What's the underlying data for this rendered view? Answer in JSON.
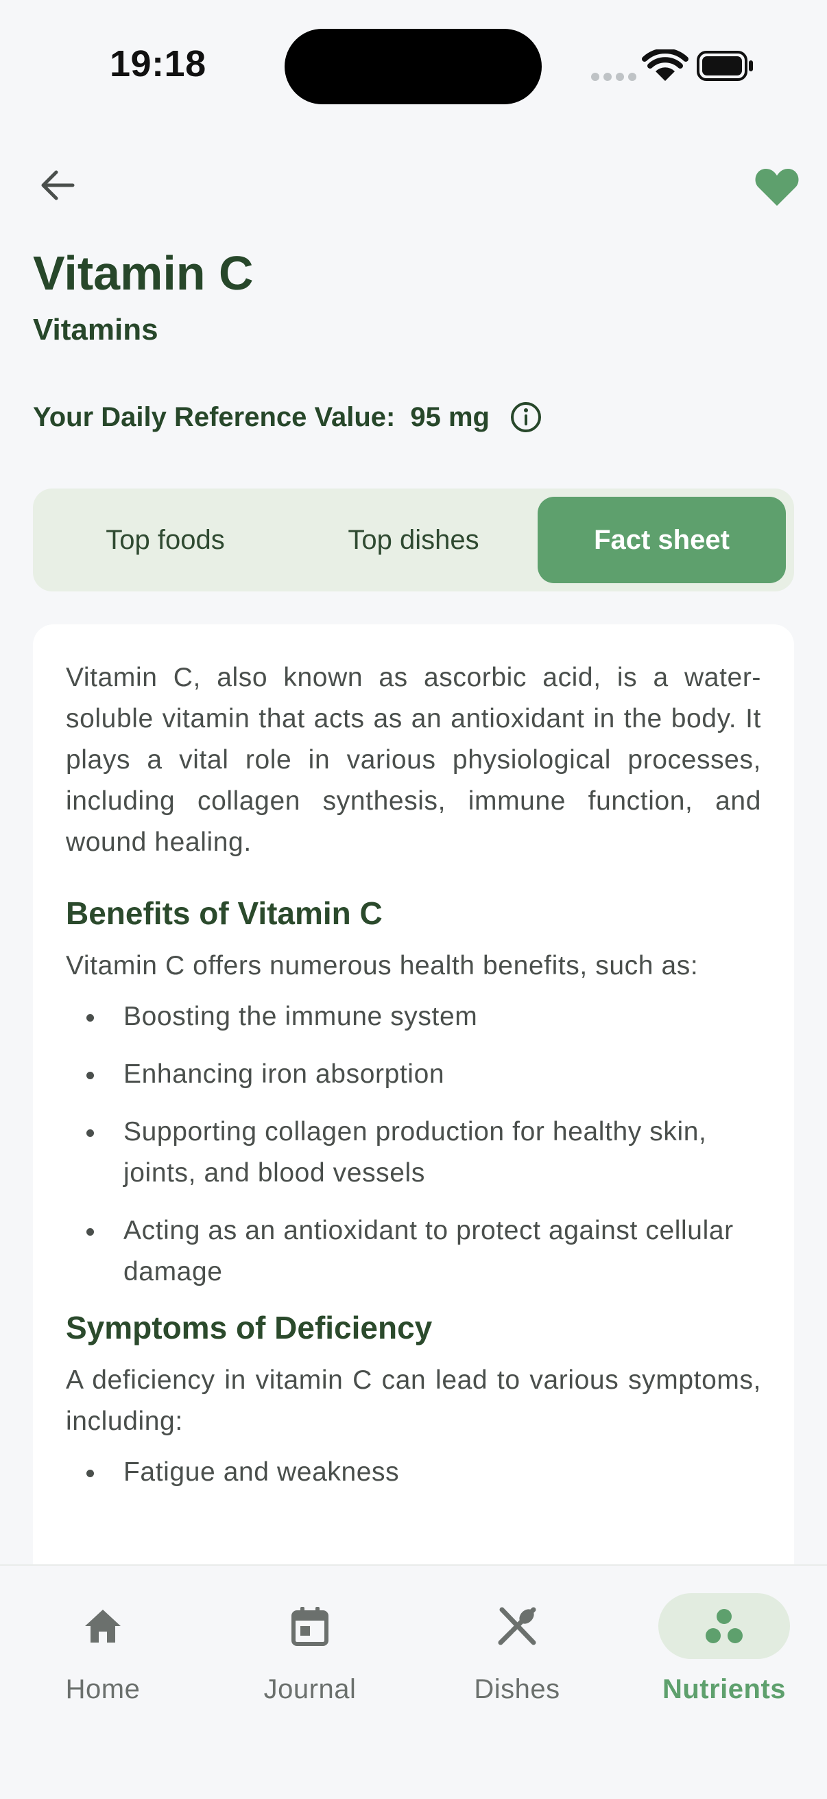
{
  "status": {
    "time": "19:18"
  },
  "header": {
    "title": "Vitamin C",
    "category": "Vitamins"
  },
  "reference": {
    "label": "Your Daily Reference Value:",
    "value": "95 mg"
  },
  "tabs": [
    {
      "label": "Top foods",
      "active": false
    },
    {
      "label": "Top dishes",
      "active": false
    },
    {
      "label": "Fact sheet",
      "active": true
    }
  ],
  "fact_sheet": {
    "intro": "Vitamin C, also known as ascorbic acid, is a water-soluble vitamin that acts as an antioxidant in the body. It plays a vital role in various physiological processes, including collagen synthesis, immune function, and wound healing.",
    "benefits_heading": "Benefits of Vitamin C",
    "benefits_intro": "Vitamin C offers numerous health benefits, such as:",
    "benefits": [
      "Boosting the immune system",
      "Enhancing iron absorption",
      "Supporting collagen production for healthy skin, joints, and blood vessels",
      "Acting as an antioxidant to protect against cellular damage"
    ],
    "deficiency_heading": "Symptoms of Deficiency",
    "deficiency_intro": "A deficiency in vitamin C can lead to various symptoms, including:",
    "deficiency": [
      "Fatigue and weakness"
    ]
  },
  "nav": [
    {
      "label": "Home",
      "icon": "home-icon",
      "active": false
    },
    {
      "label": "Journal",
      "icon": "calendar-icon",
      "active": false
    },
    {
      "label": "Dishes",
      "icon": "utensils-icon",
      "active": false
    },
    {
      "label": "Nutrients",
      "icon": "nutrients-icon",
      "active": true
    }
  ],
  "colors": {
    "accent": "#5ea06d",
    "title": "#27472a",
    "tab_bg": "#e8efe5"
  }
}
